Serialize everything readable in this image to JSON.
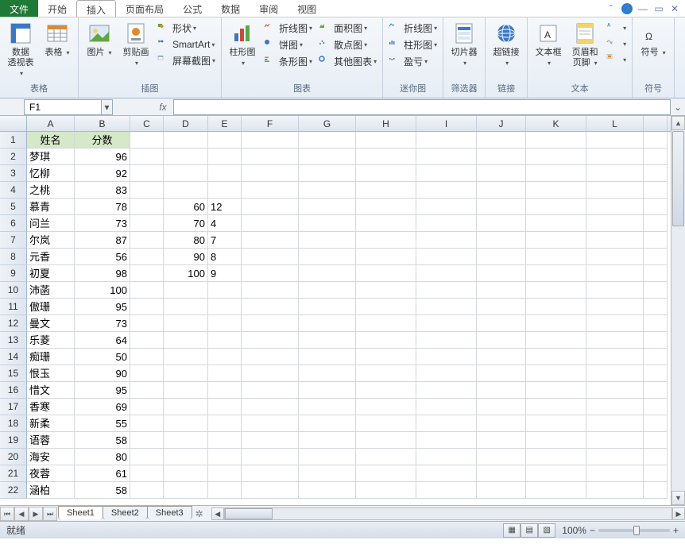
{
  "menu": {
    "file": "文件",
    "tabs": [
      "开始",
      "插入",
      "页面布局",
      "公式",
      "数据",
      "审阅",
      "视图"
    ],
    "activeIndex": 1
  },
  "ribbon": {
    "groups": [
      {
        "label": "表格",
        "items": [
          {
            "type": "big",
            "name": "pivot-table",
            "label": "数据\n透视表"
          },
          {
            "type": "big",
            "name": "table",
            "label": "表格"
          }
        ]
      },
      {
        "label": "插图",
        "items": [
          {
            "type": "big",
            "name": "picture",
            "label": "图片"
          },
          {
            "type": "big",
            "name": "clipart",
            "label": "剪贴画"
          },
          {
            "type": "stack",
            "items": [
              {
                "name": "shapes",
                "label": "形状"
              },
              {
                "name": "smartart",
                "label": "SmartArt"
              },
              {
                "name": "screenshot",
                "label": "屏幕截图"
              }
            ]
          }
        ]
      },
      {
        "label": "图表",
        "items": [
          {
            "type": "big",
            "name": "column-chart",
            "label": "柱形图"
          },
          {
            "type": "stack",
            "items": [
              {
                "name": "line-chart",
                "label": "折线图"
              },
              {
                "name": "pie-chart",
                "label": "饼图"
              },
              {
                "name": "bar-chart",
                "label": "条形图"
              }
            ]
          },
          {
            "type": "stack",
            "items": [
              {
                "name": "area-chart",
                "label": "面积图"
              },
              {
                "name": "scatter-chart",
                "label": "散点图"
              },
              {
                "name": "other-chart",
                "label": "其他图表"
              }
            ]
          }
        ]
      },
      {
        "label": "迷你图",
        "items": [
          {
            "type": "stack",
            "items": [
              {
                "name": "sparkline-line",
                "label": "折线图"
              },
              {
                "name": "sparkline-col",
                "label": "柱形图"
              },
              {
                "name": "sparkline-winloss",
                "label": "盈亏"
              }
            ]
          }
        ]
      },
      {
        "label": "筛选器",
        "items": [
          {
            "type": "big",
            "name": "slicer",
            "label": "切片器"
          }
        ]
      },
      {
        "label": "链接",
        "items": [
          {
            "type": "big",
            "name": "hyperlink",
            "label": "超链接"
          }
        ]
      },
      {
        "label": "文本",
        "items": [
          {
            "type": "big",
            "name": "textbox",
            "label": "文本框"
          },
          {
            "type": "big",
            "name": "header-footer",
            "label": "页眉和页脚"
          },
          {
            "type": "stack",
            "items": [
              {
                "name": "wordart",
                "label": ""
              },
              {
                "name": "signature",
                "label": ""
              },
              {
                "name": "object",
                "label": ""
              }
            ]
          }
        ]
      },
      {
        "label": "符号",
        "items": [
          {
            "type": "big",
            "name": "symbol",
            "label": "符号"
          }
        ]
      }
    ]
  },
  "namebox": {
    "value": "F1"
  },
  "formula": {
    "value": ""
  },
  "columns": [
    "A",
    "B",
    "C",
    "D",
    "E",
    "F",
    "G",
    "H",
    "I",
    "J",
    "K",
    "L"
  ],
  "rows": [
    {
      "n": 1,
      "cells": {
        "A": {
          "v": "姓名",
          "cls": "hdr"
        },
        "B": {
          "v": "分数",
          "cls": "hdr"
        }
      }
    },
    {
      "n": 2,
      "cells": {
        "A": {
          "v": "梦琪",
          "cls": "txt"
        },
        "B": {
          "v": "96",
          "cls": "num"
        }
      }
    },
    {
      "n": 3,
      "cells": {
        "A": {
          "v": "忆柳",
          "cls": "txt"
        },
        "B": {
          "v": "92",
          "cls": "num"
        }
      }
    },
    {
      "n": 4,
      "cells": {
        "A": {
          "v": "之桃",
          "cls": "txt"
        },
        "B": {
          "v": "83",
          "cls": "num"
        }
      }
    },
    {
      "n": 5,
      "cells": {
        "A": {
          "v": "慕青",
          "cls": "txt"
        },
        "B": {
          "v": "78",
          "cls": "num"
        },
        "D": {
          "v": "60",
          "cls": "num"
        },
        "E": {
          "v": "12",
          "cls": "txt"
        }
      }
    },
    {
      "n": 6,
      "cells": {
        "A": {
          "v": "问兰",
          "cls": "txt"
        },
        "B": {
          "v": "73",
          "cls": "num"
        },
        "D": {
          "v": "70",
          "cls": "num"
        },
        "E": {
          "v": "4",
          "cls": "txt"
        }
      }
    },
    {
      "n": 7,
      "cells": {
        "A": {
          "v": "尔岚",
          "cls": "txt"
        },
        "B": {
          "v": "87",
          "cls": "num"
        },
        "D": {
          "v": "80",
          "cls": "num"
        },
        "E": {
          "v": "7",
          "cls": "txt"
        }
      }
    },
    {
      "n": 8,
      "cells": {
        "A": {
          "v": "元香",
          "cls": "txt"
        },
        "B": {
          "v": "56",
          "cls": "num"
        },
        "D": {
          "v": "90",
          "cls": "num"
        },
        "E": {
          "v": "8",
          "cls": "txt"
        }
      }
    },
    {
      "n": 9,
      "cells": {
        "A": {
          "v": "初夏",
          "cls": "txt"
        },
        "B": {
          "v": "98",
          "cls": "num"
        },
        "D": {
          "v": "100",
          "cls": "num"
        },
        "E": {
          "v": "9",
          "cls": "txt"
        }
      }
    },
    {
      "n": 10,
      "cells": {
        "A": {
          "v": "沛菡",
          "cls": "txt"
        },
        "B": {
          "v": "100",
          "cls": "num"
        }
      }
    },
    {
      "n": 11,
      "cells": {
        "A": {
          "v": "傲珊",
          "cls": "txt"
        },
        "B": {
          "v": "95",
          "cls": "num"
        }
      }
    },
    {
      "n": 12,
      "cells": {
        "A": {
          "v": "曼文",
          "cls": "txt"
        },
        "B": {
          "v": "73",
          "cls": "num"
        }
      }
    },
    {
      "n": 13,
      "cells": {
        "A": {
          "v": "乐菱",
          "cls": "txt"
        },
        "B": {
          "v": "64",
          "cls": "num"
        }
      }
    },
    {
      "n": 14,
      "cells": {
        "A": {
          "v": "痴珊",
          "cls": "txt"
        },
        "B": {
          "v": "50",
          "cls": "num"
        }
      }
    },
    {
      "n": 15,
      "cells": {
        "A": {
          "v": "恨玉",
          "cls": "txt"
        },
        "B": {
          "v": "90",
          "cls": "num"
        }
      }
    },
    {
      "n": 16,
      "cells": {
        "A": {
          "v": "惜文",
          "cls": "txt"
        },
        "B": {
          "v": "95",
          "cls": "num"
        }
      }
    },
    {
      "n": 17,
      "cells": {
        "A": {
          "v": "香寒",
          "cls": "txt"
        },
        "B": {
          "v": "69",
          "cls": "num"
        }
      }
    },
    {
      "n": 18,
      "cells": {
        "A": {
          "v": "新柔",
          "cls": "txt"
        },
        "B": {
          "v": "55",
          "cls": "num"
        }
      }
    },
    {
      "n": 19,
      "cells": {
        "A": {
          "v": "语蓉",
          "cls": "txt"
        },
        "B": {
          "v": "58",
          "cls": "num"
        }
      }
    },
    {
      "n": 20,
      "cells": {
        "A": {
          "v": "海安",
          "cls": "txt"
        },
        "B": {
          "v": "80",
          "cls": "num"
        }
      }
    },
    {
      "n": 21,
      "cells": {
        "A": {
          "v": "夜蓉",
          "cls": "txt"
        },
        "B": {
          "v": "61",
          "cls": "num"
        }
      }
    },
    {
      "n": 22,
      "cells": {
        "A": {
          "v": "涵柏",
          "cls": "txt"
        },
        "B": {
          "v": "58",
          "cls": "num"
        }
      }
    }
  ],
  "sheets": [
    "Sheet1",
    "Sheet2",
    "Sheet3"
  ],
  "activeSheet": 0,
  "status": {
    "ready": "就绪",
    "zoom": "100%"
  }
}
